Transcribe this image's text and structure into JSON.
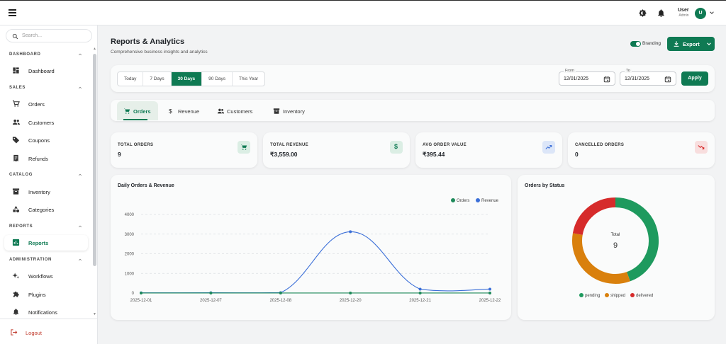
{
  "header": {
    "user_name": "User",
    "user_role": "Admin",
    "avatar_initial": "U"
  },
  "sidebar": {
    "search_placeholder": "Search...",
    "sections": {
      "dashboard": "DASHBOARD",
      "sales": "SALES",
      "catalog": "CATALOG",
      "reports": "REPORTS",
      "administration": "ADMINISTRATION"
    },
    "items": {
      "dashboard": "Dashboard",
      "orders": "Orders",
      "customers": "Customers",
      "coupons": "Coupons",
      "refunds": "Refunds",
      "inventory": "Inventory",
      "categories": "Categories",
      "reports": "Reports",
      "workflows": "Workflows",
      "plugins": "Plugins",
      "notifications": "Notifications"
    },
    "logout": "Logout"
  },
  "page": {
    "title": "Reports & Analytics",
    "subtitle": "Comprehensive business insights and analytics",
    "branding_label": "Branding",
    "export_label": "Export"
  },
  "filters": {
    "ranges": [
      "Today",
      "7 Days",
      "30 Days",
      "90 Days",
      "This Year"
    ],
    "selected_range": "30 Days",
    "from_label": "From",
    "from_value": "12/01/2025",
    "to_label": "To",
    "to_value": "12/31/2025",
    "apply_label": "Apply"
  },
  "tabs": [
    "Orders",
    "Revenue",
    "Customers",
    "Inventory"
  ],
  "stats": [
    {
      "title": "TOTAL ORDERS",
      "value": "9"
    },
    {
      "title": "TOTAL REVENUE",
      "value": "₹3,559.00"
    },
    {
      "title": "AVG ORDER VALUE",
      "value": "₹395.44"
    },
    {
      "title": "CANCELLED ORDERS",
      "value": "0"
    }
  ],
  "colors": {
    "accent": "#0f7a53",
    "orders_series": "#1e8a5a",
    "revenue_series": "#3b6fd8",
    "pending": "#1e9a5e",
    "shipped": "#d9800d",
    "delivered": "#d62b2b"
  },
  "chart_data": [
    {
      "type": "line",
      "title": "Daily Orders & Revenue",
      "x": [
        "2025-12-01",
        "2025-12-07",
        "2025-12-08",
        "2025-12-20",
        "2025-12-21",
        "2025-12-22"
      ],
      "yticks": [
        "4000",
        "3000",
        "2000",
        "1000",
        "0"
      ],
      "ylim": [
        0,
        4000
      ],
      "grid": true,
      "legend_position": "top-right",
      "series": [
        {
          "name": "Orders",
          "values": [
            1,
            1,
            2,
            1,
            2,
            2
          ]
        },
        {
          "name": "Revenue",
          "values": [
            10,
            15,
            20,
            3120,
            199,
            200
          ]
        }
      ]
    },
    {
      "type": "pie",
      "title": "Orders by Status",
      "center_label": "Total",
      "center_value": "9",
      "legend_position": "bottom",
      "slices": [
        {
          "name": "pending",
          "value": 4
        },
        {
          "name": "shipped",
          "value": 3
        },
        {
          "name": "delivered",
          "value": 2
        }
      ]
    }
  ]
}
